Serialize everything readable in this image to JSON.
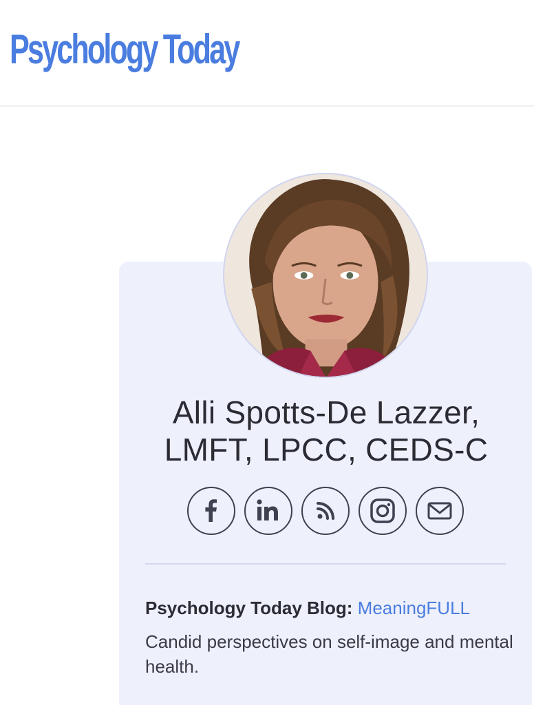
{
  "header": {
    "logo_text": "Psychology Today"
  },
  "profile": {
    "name_line1": "Alli Spotts-De Lazzer,",
    "name_line2": "LMFT, LPCC, CEDS-C",
    "photo_alt": "Alli Spotts-De Lazzer"
  },
  "socials": [
    {
      "icon": "facebook-icon"
    },
    {
      "icon": "linkedin-icon"
    },
    {
      "icon": "rss-icon"
    },
    {
      "icon": "instagram-icon"
    },
    {
      "icon": "email-icon"
    }
  ],
  "blog": {
    "label": "Psychology Today Blog:",
    "link_text": "MeaningFULL",
    "description": "Candid perspectives on self-image and mental health."
  },
  "colors": {
    "brand_blue": "#4a7ddf",
    "card_background": "#eef0fc",
    "icon_stroke": "#3e4150"
  }
}
